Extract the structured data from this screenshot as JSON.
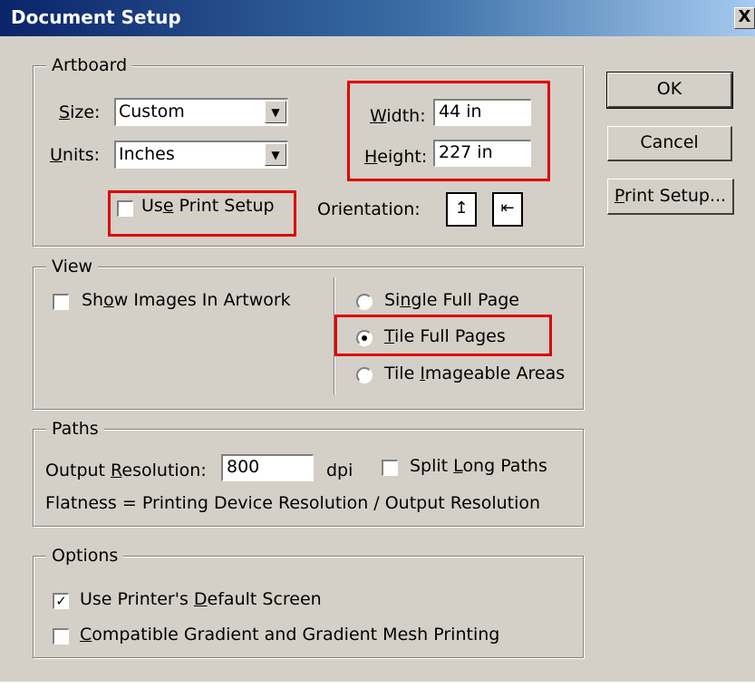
{
  "window": {
    "title": "Document Setup",
    "close_label": "X"
  },
  "artboard": {
    "legend": "Artboard",
    "size_label_pre": "",
    "size_label_u": "S",
    "size_label_post": "ize:",
    "size_value": "Custom",
    "units_label_u": "U",
    "units_label_post": "nits:",
    "units_value": "Inches",
    "width_label_u": "W",
    "width_label_post": "idth:",
    "width_value": "44 in",
    "height_label_u": "H",
    "height_label_post": "eight:",
    "height_value": "227 in",
    "use_print_setup_pre": "Us",
    "use_print_setup_u": "e",
    "use_print_setup_post": " Print Setup",
    "use_print_setup_checked": false,
    "orientation_label": "Orientation:",
    "portrait_glyph": "↥",
    "landscape_glyph": "⇤"
  },
  "view": {
    "legend": "View",
    "show_images_pre": "Sh",
    "show_images_u": "o",
    "show_images_post": "w Images In Artwork",
    "show_images_checked": false,
    "single_pre": "Si",
    "single_u": "n",
    "single_post": "gle Full Page",
    "tile_full_u": "T",
    "tile_full_post": "ile Full Pages",
    "tile_imageable_pre": "Tile ",
    "tile_imageable_u": "I",
    "tile_imageable_post": "mageable Areas",
    "selected": "Tile Full Pages"
  },
  "paths": {
    "legend": "Paths",
    "output_res_pre": "Output ",
    "output_res_u": "R",
    "output_res_post": "esolution:",
    "output_res_value": "800",
    "dpi_label": "dpi",
    "split_pre": "Split ",
    "split_u": "L",
    "split_post": "ong Paths",
    "split_checked": false,
    "flatness_text": "Flatness = Printing Device Resolution / Output Resolution"
  },
  "options": {
    "legend": "Options",
    "default_screen_pre": "Use Printer's ",
    "default_screen_u": "D",
    "default_screen_post": "efault Screen",
    "default_screen_checked": true,
    "check_mark": "✓",
    "gradient_pre": "",
    "gradient_u": "C",
    "gradient_post": "ompatible Gradient and Gradient Mesh Printing",
    "gradient_checked": false
  },
  "buttons": {
    "ok": "OK",
    "cancel": "Cancel",
    "print_setup_u": "P",
    "print_setup_post": "rint Setup..."
  },
  "combo_arrow": "▼",
  "highlight_color": "#e00000"
}
